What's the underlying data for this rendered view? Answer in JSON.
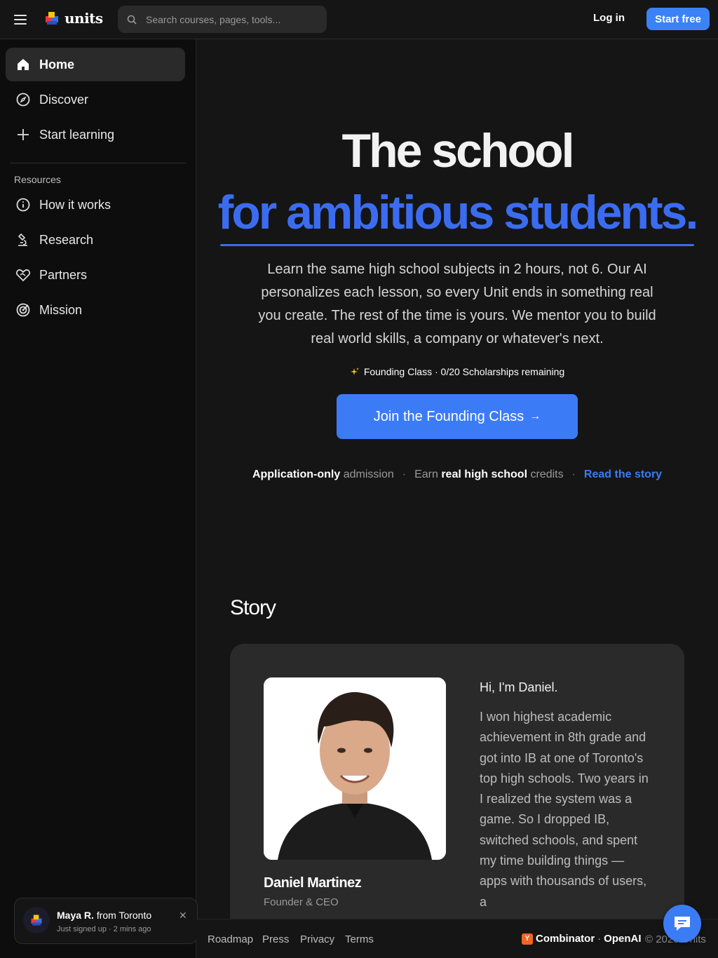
{
  "header": {
    "logo_text": "units",
    "search_placeholder": "Search courses, pages, tools...",
    "login_label": "Log in",
    "start_free_label": "Start free"
  },
  "sidebar": {
    "items": [
      {
        "label": "Home",
        "icon": "home-icon"
      },
      {
        "label": "Discover",
        "icon": "compass-icon"
      },
      {
        "label": "Start learning",
        "icon": "plus-icon"
      }
    ],
    "resources_label": "Resources",
    "resources": [
      {
        "label": "How it works",
        "icon": "info-icon"
      },
      {
        "label": "Research",
        "icon": "microscope-icon"
      },
      {
        "label": "Partners",
        "icon": "handshake-heart-icon"
      },
      {
        "label": "Mission",
        "icon": "target-icon"
      }
    ]
  },
  "toast": {
    "name": "Maya R.",
    "from": "from Toronto",
    "sub": "Just signed up · 2 mins ago"
  },
  "hero": {
    "line1": "The school",
    "line2": "for ambitious students.",
    "lead": "Learn the same high school subjects in 2 hours, not 6. Our AI personalizes each lesson, so every Unit ends in something real you create. The rest of the time is yours. We mentor you to build real world skills, a company or whatever's next.",
    "founding": "Founding Class · 0/20 Scholarships remaining",
    "cta_label": "Join the Founding Class",
    "facts": {
      "f1_bold": "Application-only",
      "f1_rest": "admission",
      "f2_pre": "Earn",
      "f2_bold": "real high school",
      "f2_rest": "credits",
      "link": "Read the story"
    }
  },
  "story": {
    "title": "Story",
    "person_name": "Daniel Martinez",
    "person_role": "Founder & CEO",
    "greeting": "Hi, I'm Daniel.",
    "body": "I won highest academic achievement in 8th grade and got into IB at one of Toronto's top high schools. Two years in I realized the system was a game. So I dropped IB, switched schools, and spent my time building things — apps with thousands of users, a"
  },
  "footer": {
    "links": [
      "Roadmap",
      "Press",
      "Privacy",
      "Terms"
    ],
    "yc_letter": "Y",
    "combinator": "Combinator",
    "dot": "·",
    "openai": "OpenAI",
    "copyright": "© 2025 Units"
  },
  "colors": {
    "accent": "#3b7cf6",
    "headline_blue": "#3b6cf0",
    "background": "#151515",
    "sidebar": "#0d0d0d"
  }
}
